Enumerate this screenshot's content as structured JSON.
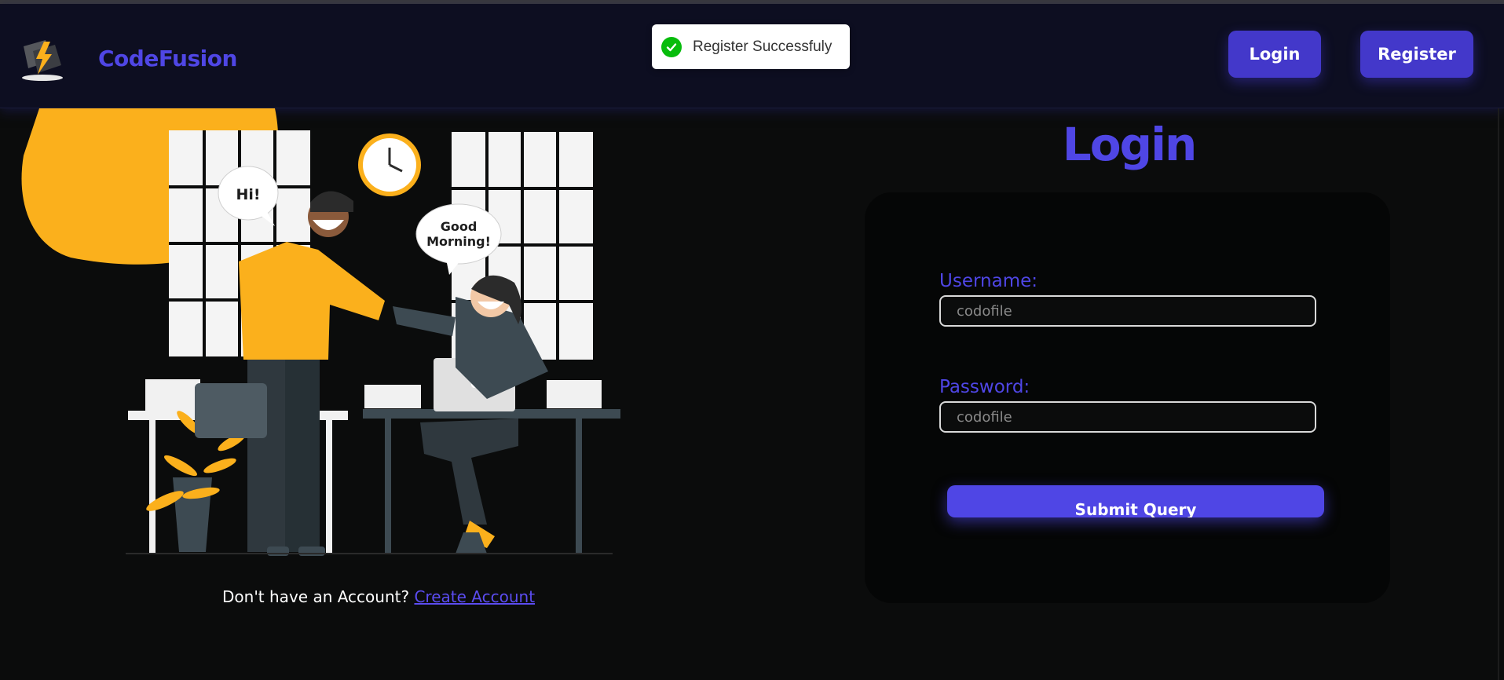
{
  "header": {
    "brand": "CodeFusion",
    "nav": {
      "login_label": "Login",
      "register_label": "Register"
    }
  },
  "toast": {
    "message": "Register Successfuly",
    "icon": "check-circle-icon",
    "color": "#07bc0c"
  },
  "illustration": {
    "speech_left": "Hi!",
    "speech_right_line1": "Good",
    "speech_right_line2": "Morning!"
  },
  "signup": {
    "prompt": "Don't have an Account?",
    "link_label": "Create Account"
  },
  "login_form": {
    "title": "Login",
    "username_label": "Username:",
    "username_placeholder": "codofile",
    "password_label": "Password:",
    "password_placeholder": "codofile",
    "submit_label": "Submit Query"
  },
  "colors": {
    "accent": "#4f46e5",
    "illustration_yellow": "#fbb01c",
    "background": "#0b0c0c"
  }
}
